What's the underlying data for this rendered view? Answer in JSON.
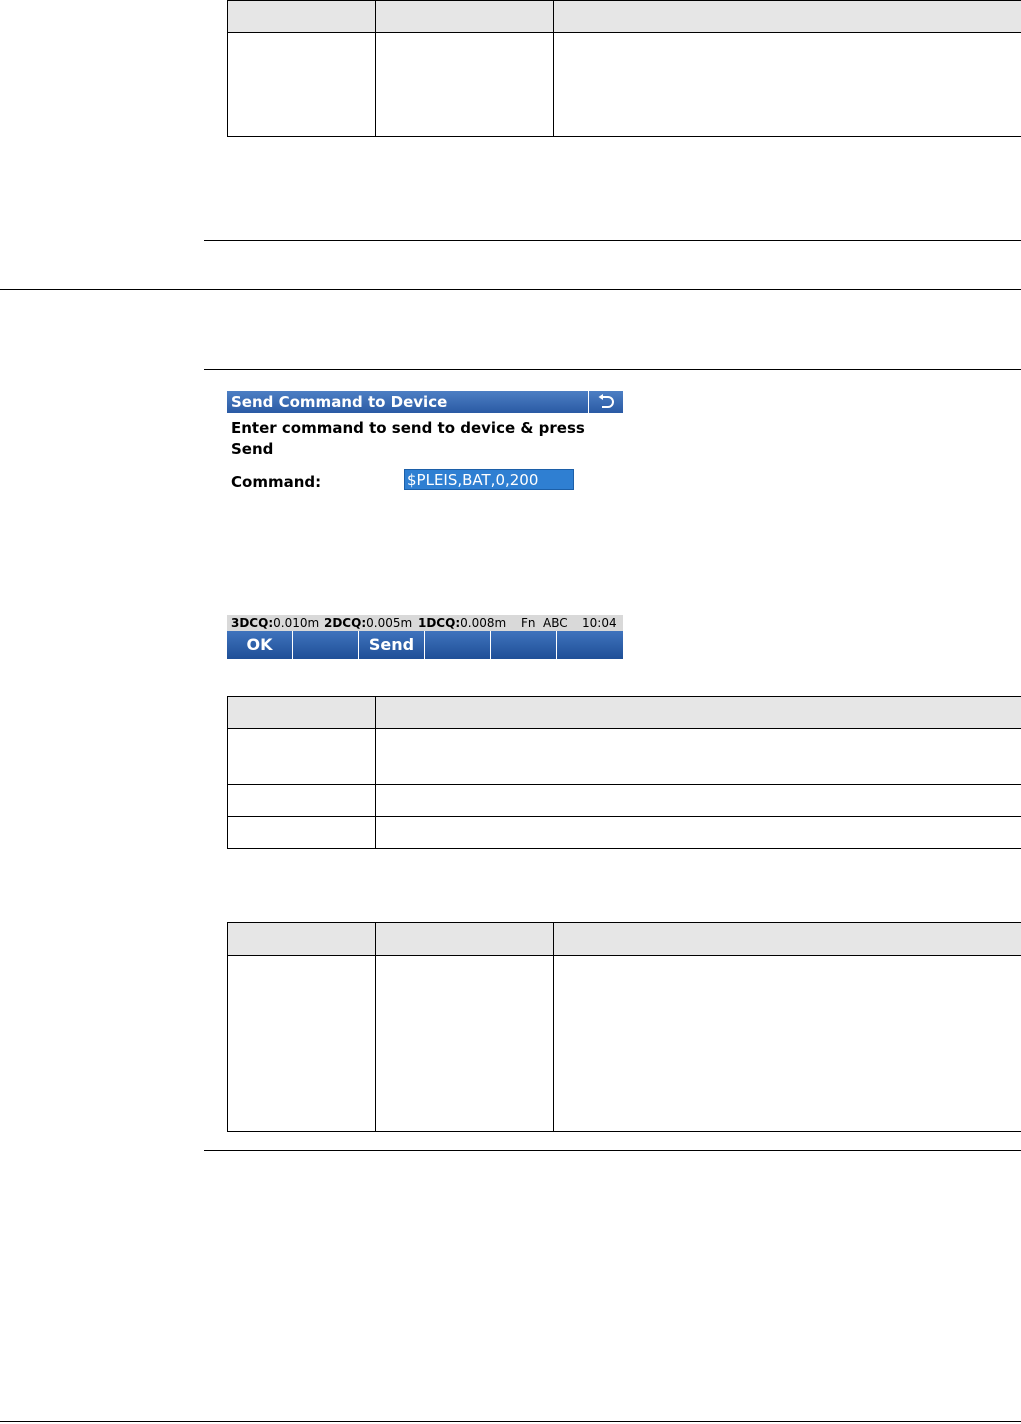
{
  "screen": {
    "title": "Send Command to Device",
    "back_icon": "undo-arrow-icon",
    "prompt": "Enter command to send to device & press Send",
    "command_label": "Command:",
    "command_value": "$PLEIS,BAT,0,200"
  },
  "status": {
    "q3_label": "3DCQ:",
    "q3_value": "0.010m",
    "q2_label": "2DCQ:",
    "q2_value": "0.005m",
    "q1_label": "1DCQ:",
    "q1_value": "0.008m",
    "fn": "Fn",
    "mode": "ABC",
    "time": "10:04"
  },
  "softkeys": [
    "OK",
    "",
    "Send",
    "",
    "",
    ""
  ]
}
